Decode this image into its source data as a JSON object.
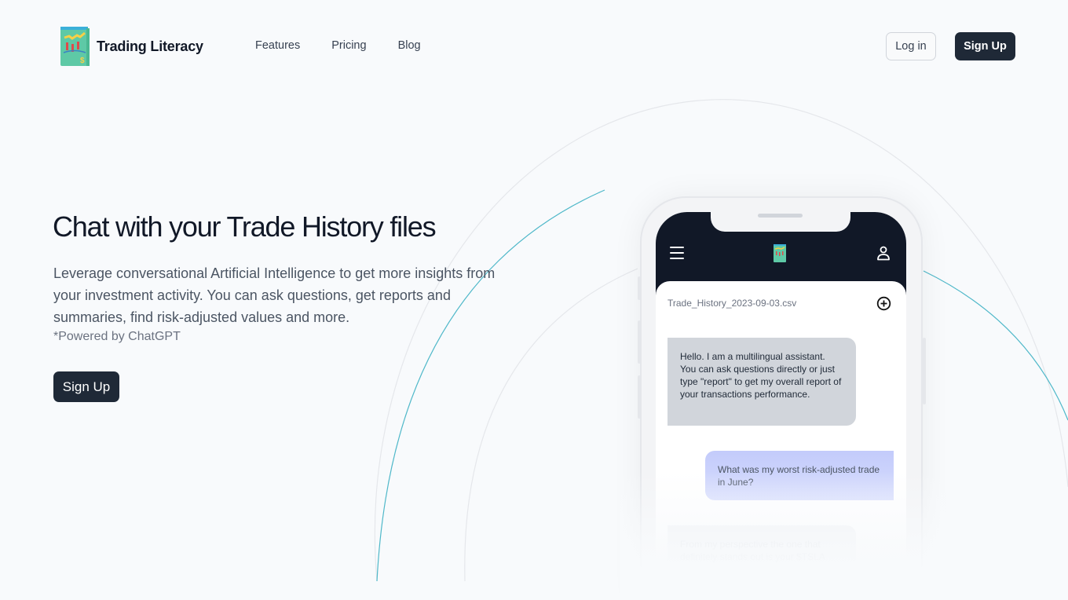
{
  "header": {
    "brand": "Trading Literacy",
    "nav": [
      {
        "label": "Features"
      },
      {
        "label": "Pricing"
      },
      {
        "label": "Blog"
      }
    ],
    "login_label": "Log in",
    "signup_label": "Sign Up"
  },
  "hero": {
    "title": "Chat with your Trade History files",
    "description": "Leverage conversational Artificial Intelligence to get more insights from your investment activity. You can ask questions, get reports and summaries, find risk-adjusted values and more.",
    "note": "*Powered by ChatGPT",
    "signup_label": "Sign Up"
  },
  "phone": {
    "file_name": "Trade_History_2023-09-03.csv",
    "icons": {
      "menu": "menu-icon",
      "logo": "app-logo-icon",
      "user": "user-icon",
      "add": "add-circle-icon"
    },
    "messages": [
      {
        "role": "assistant",
        "text": "Hello. I am a multilingual assistant. You can ask questions directly or just type \"report\" to get my overall report of your transactions performance."
      },
      {
        "role": "user",
        "text": "What was my worst risk-adjusted trade in June?"
      },
      {
        "role": "assistant",
        "text": "From my perspective the one that definitely stands out is your $TSLA"
      }
    ]
  },
  "colors": {
    "background": "#f8fafc",
    "primary_button": "#1f2937",
    "phone_header": "#111827",
    "bot_bubble": "#d1d5db",
    "user_bubble": "#c3cbfb",
    "accent_arc": "#38b2c7"
  }
}
